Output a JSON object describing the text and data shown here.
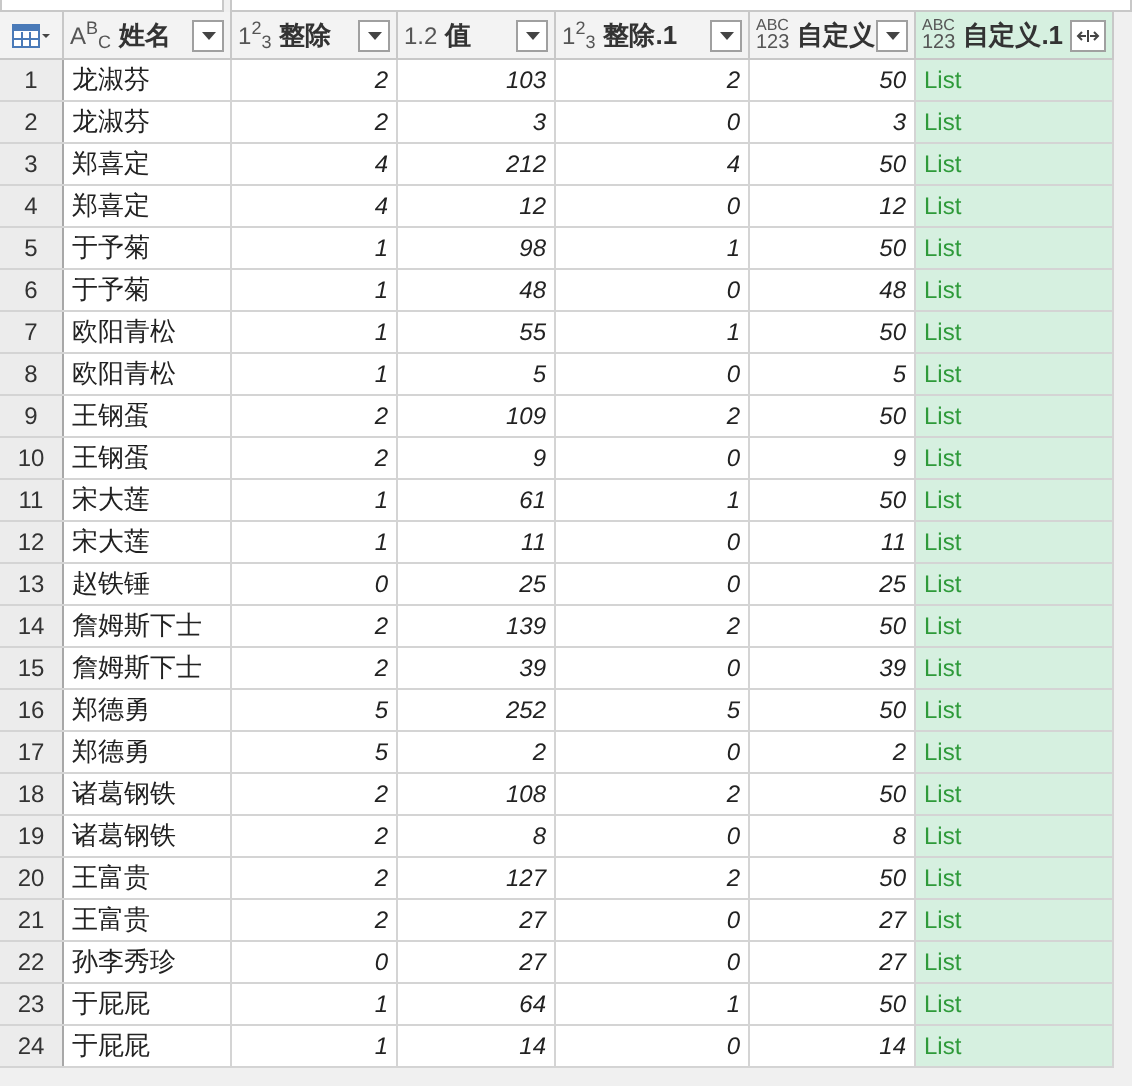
{
  "columns": [
    {
      "name": "姓名",
      "type_label": "A$^{B}$$_{C}$",
      "kind": "text",
      "selected": false,
      "expandable": false
    },
    {
      "name": "整除",
      "type_label": "1$^{2}$$_{3}$",
      "kind": "number",
      "selected": false,
      "expandable": false
    },
    {
      "name": "值",
      "type_label": "1.2",
      "kind": "number",
      "selected": false,
      "expandable": false
    },
    {
      "name": "整除.1",
      "type_label": "1$^{2}$$_{3}$",
      "kind": "number",
      "selected": false,
      "expandable": false
    },
    {
      "name": "自定义",
      "type_lines": [
        "ABC",
        "123"
      ],
      "kind": "number",
      "selected": false,
      "expandable": false
    },
    {
      "name": "自定义.1",
      "type_lines": [
        "ABC",
        "123"
      ],
      "kind": "list",
      "selected": true,
      "expandable": true
    }
  ],
  "rows": [
    {
      "index": "1",
      "name": "龙淑芬",
      "divide": "2",
      "value": "103",
      "divide_1": "2",
      "custom": "50",
      "custom_1": "List"
    },
    {
      "index": "2",
      "name": "龙淑芬",
      "divide": "2",
      "value": "3",
      "divide_1": "0",
      "custom": "3",
      "custom_1": "List"
    },
    {
      "index": "3",
      "name": "郑喜定",
      "divide": "4",
      "value": "212",
      "divide_1": "4",
      "custom": "50",
      "custom_1": "List"
    },
    {
      "index": "4",
      "name": "郑喜定",
      "divide": "4",
      "value": "12",
      "divide_1": "0",
      "custom": "12",
      "custom_1": "List"
    },
    {
      "index": "5",
      "name": "于予菊",
      "divide": "1",
      "value": "98",
      "divide_1": "1",
      "custom": "50",
      "custom_1": "List"
    },
    {
      "index": "6",
      "name": "于予菊",
      "divide": "1",
      "value": "48",
      "divide_1": "0",
      "custom": "48",
      "custom_1": "List"
    },
    {
      "index": "7",
      "name": "欧阳青松",
      "divide": "1",
      "value": "55",
      "divide_1": "1",
      "custom": "50",
      "custom_1": "List"
    },
    {
      "index": "8",
      "name": "欧阳青松",
      "divide": "1",
      "value": "5",
      "divide_1": "0",
      "custom": "5",
      "custom_1": "List"
    },
    {
      "index": "9",
      "name": "王钢蛋",
      "divide": "2",
      "value": "109",
      "divide_1": "2",
      "custom": "50",
      "custom_1": "List"
    },
    {
      "index": "10",
      "name": "王钢蛋",
      "divide": "2",
      "value": "9",
      "divide_1": "0",
      "custom": "9",
      "custom_1": "List"
    },
    {
      "index": "11",
      "name": "宋大莲",
      "divide": "1",
      "value": "61",
      "divide_1": "1",
      "custom": "50",
      "custom_1": "List"
    },
    {
      "index": "12",
      "name": "宋大莲",
      "divide": "1",
      "value": "11",
      "divide_1": "0",
      "custom": "11",
      "custom_1": "List"
    },
    {
      "index": "13",
      "name": "赵铁锤",
      "divide": "0",
      "value": "25",
      "divide_1": "0",
      "custom": "25",
      "custom_1": "List"
    },
    {
      "index": "14",
      "name": "詹姆斯下士",
      "divide": "2",
      "value": "139",
      "divide_1": "2",
      "custom": "50",
      "custom_1": "List"
    },
    {
      "index": "15",
      "name": "詹姆斯下士",
      "divide": "2",
      "value": "39",
      "divide_1": "0",
      "custom": "39",
      "custom_1": "List"
    },
    {
      "index": "16",
      "name": "郑德勇",
      "divide": "5",
      "value": "252",
      "divide_1": "5",
      "custom": "50",
      "custom_1": "List"
    },
    {
      "index": "17",
      "name": "郑德勇",
      "divide": "5",
      "value": "2",
      "divide_1": "0",
      "custom": "2",
      "custom_1": "List"
    },
    {
      "index": "18",
      "name": "诸葛钢铁",
      "divide": "2",
      "value": "108",
      "divide_1": "2",
      "custom": "50",
      "custom_1": "List"
    },
    {
      "index": "19",
      "name": "诸葛钢铁",
      "divide": "2",
      "value": "8",
      "divide_1": "0",
      "custom": "8",
      "custom_1": "List"
    },
    {
      "index": "20",
      "name": "王富贵",
      "divide": "2",
      "value": "127",
      "divide_1": "2",
      "custom": "50",
      "custom_1": "List"
    },
    {
      "index": "21",
      "name": "王富贵",
      "divide": "2",
      "value": "27",
      "divide_1": "0",
      "custom": "27",
      "custom_1": "List"
    },
    {
      "index": "22",
      "name": "孙李秀珍",
      "divide": "0",
      "value": "27",
      "divide_1": "0",
      "custom": "27",
      "custom_1": "List"
    },
    {
      "index": "23",
      "name": "于屁屁",
      "divide": "1",
      "value": "64",
      "divide_1": "1",
      "custom": "50",
      "custom_1": "List"
    },
    {
      "index": "24",
      "name": "于屁屁",
      "divide": "1",
      "value": "14",
      "divide_1": "0",
      "custom": "14",
      "custom_1": "List"
    }
  ]
}
